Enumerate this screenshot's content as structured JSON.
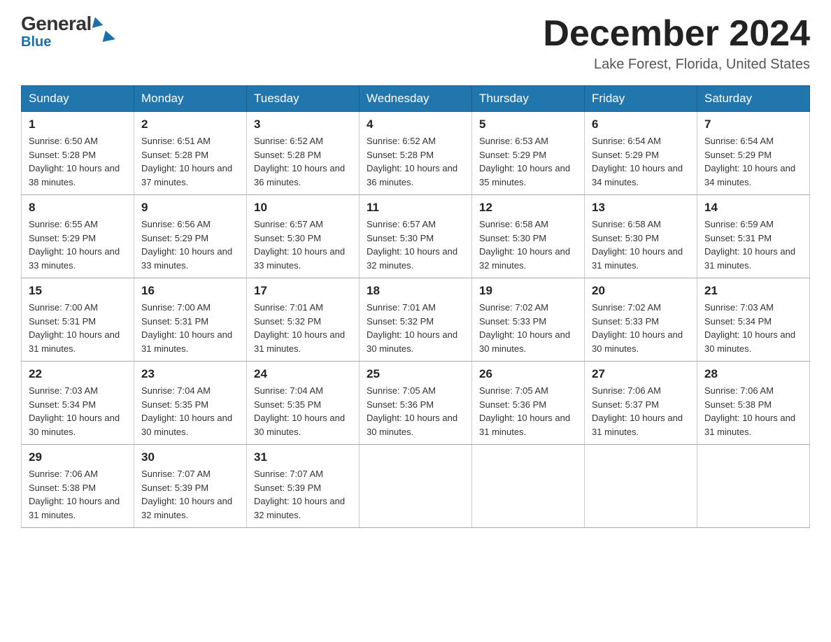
{
  "logo": {
    "name_black": "General",
    "arrow_shape": "triangle",
    "name_blue": "Blue"
  },
  "header": {
    "title": "December 2024",
    "subtitle": "Lake Forest, Florida, United States"
  },
  "days_of_week": [
    "Sunday",
    "Monday",
    "Tuesday",
    "Wednesday",
    "Thursday",
    "Friday",
    "Saturday"
  ],
  "weeks": [
    [
      {
        "day": "1",
        "sunrise": "6:50 AM",
        "sunset": "5:28 PM",
        "daylight": "10 hours and 38 minutes."
      },
      {
        "day": "2",
        "sunrise": "6:51 AM",
        "sunset": "5:28 PM",
        "daylight": "10 hours and 37 minutes."
      },
      {
        "day": "3",
        "sunrise": "6:52 AM",
        "sunset": "5:28 PM",
        "daylight": "10 hours and 36 minutes."
      },
      {
        "day": "4",
        "sunrise": "6:52 AM",
        "sunset": "5:28 PM",
        "daylight": "10 hours and 36 minutes."
      },
      {
        "day": "5",
        "sunrise": "6:53 AM",
        "sunset": "5:29 PM",
        "daylight": "10 hours and 35 minutes."
      },
      {
        "day": "6",
        "sunrise": "6:54 AM",
        "sunset": "5:29 PM",
        "daylight": "10 hours and 34 minutes."
      },
      {
        "day": "7",
        "sunrise": "6:54 AM",
        "sunset": "5:29 PM",
        "daylight": "10 hours and 34 minutes."
      }
    ],
    [
      {
        "day": "8",
        "sunrise": "6:55 AM",
        "sunset": "5:29 PM",
        "daylight": "10 hours and 33 minutes."
      },
      {
        "day": "9",
        "sunrise": "6:56 AM",
        "sunset": "5:29 PM",
        "daylight": "10 hours and 33 minutes."
      },
      {
        "day": "10",
        "sunrise": "6:57 AM",
        "sunset": "5:30 PM",
        "daylight": "10 hours and 33 minutes."
      },
      {
        "day": "11",
        "sunrise": "6:57 AM",
        "sunset": "5:30 PM",
        "daylight": "10 hours and 32 minutes."
      },
      {
        "day": "12",
        "sunrise": "6:58 AM",
        "sunset": "5:30 PM",
        "daylight": "10 hours and 32 minutes."
      },
      {
        "day": "13",
        "sunrise": "6:58 AM",
        "sunset": "5:30 PM",
        "daylight": "10 hours and 31 minutes."
      },
      {
        "day": "14",
        "sunrise": "6:59 AM",
        "sunset": "5:31 PM",
        "daylight": "10 hours and 31 minutes."
      }
    ],
    [
      {
        "day": "15",
        "sunrise": "7:00 AM",
        "sunset": "5:31 PM",
        "daylight": "10 hours and 31 minutes."
      },
      {
        "day": "16",
        "sunrise": "7:00 AM",
        "sunset": "5:31 PM",
        "daylight": "10 hours and 31 minutes."
      },
      {
        "day": "17",
        "sunrise": "7:01 AM",
        "sunset": "5:32 PM",
        "daylight": "10 hours and 31 minutes."
      },
      {
        "day": "18",
        "sunrise": "7:01 AM",
        "sunset": "5:32 PM",
        "daylight": "10 hours and 30 minutes."
      },
      {
        "day": "19",
        "sunrise": "7:02 AM",
        "sunset": "5:33 PM",
        "daylight": "10 hours and 30 minutes."
      },
      {
        "day": "20",
        "sunrise": "7:02 AM",
        "sunset": "5:33 PM",
        "daylight": "10 hours and 30 minutes."
      },
      {
        "day": "21",
        "sunrise": "7:03 AM",
        "sunset": "5:34 PM",
        "daylight": "10 hours and 30 minutes."
      }
    ],
    [
      {
        "day": "22",
        "sunrise": "7:03 AM",
        "sunset": "5:34 PM",
        "daylight": "10 hours and 30 minutes."
      },
      {
        "day": "23",
        "sunrise": "7:04 AM",
        "sunset": "5:35 PM",
        "daylight": "10 hours and 30 minutes."
      },
      {
        "day": "24",
        "sunrise": "7:04 AM",
        "sunset": "5:35 PM",
        "daylight": "10 hours and 30 minutes."
      },
      {
        "day": "25",
        "sunrise": "7:05 AM",
        "sunset": "5:36 PM",
        "daylight": "10 hours and 30 minutes."
      },
      {
        "day": "26",
        "sunrise": "7:05 AM",
        "sunset": "5:36 PM",
        "daylight": "10 hours and 31 minutes."
      },
      {
        "day": "27",
        "sunrise": "7:06 AM",
        "sunset": "5:37 PM",
        "daylight": "10 hours and 31 minutes."
      },
      {
        "day": "28",
        "sunrise": "7:06 AM",
        "sunset": "5:38 PM",
        "daylight": "10 hours and 31 minutes."
      }
    ],
    [
      {
        "day": "29",
        "sunrise": "7:06 AM",
        "sunset": "5:38 PM",
        "daylight": "10 hours and 31 minutes."
      },
      {
        "day": "30",
        "sunrise": "7:07 AM",
        "sunset": "5:39 PM",
        "daylight": "10 hours and 32 minutes."
      },
      {
        "day": "31",
        "sunrise": "7:07 AM",
        "sunset": "5:39 PM",
        "daylight": "10 hours and 32 minutes."
      },
      null,
      null,
      null,
      null
    ]
  ],
  "labels": {
    "sunrise": "Sunrise:",
    "sunset": "Sunset:",
    "daylight": "Daylight:"
  }
}
